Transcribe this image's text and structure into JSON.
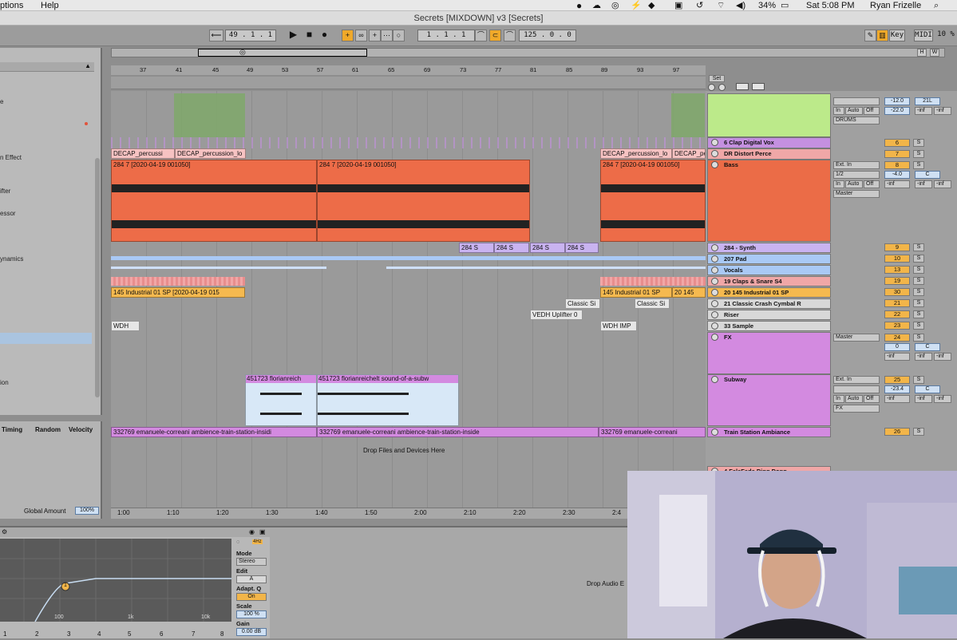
{
  "menubar": {
    "left_items": [
      "ptions",
      "Help"
    ],
    "battery": "34%",
    "clock": "Sat 5:08 PM",
    "user": "Ryan Frizelle"
  },
  "window": {
    "title": "Secrets [MIXDOWN] v3  [Secrets]"
  },
  "transport": {
    "tempo_position": "49 . 1 . 1",
    "loop_start": "1 . 1 . 1",
    "loop_length": "125 . 0 . 0",
    "key_label": "Key",
    "midi_label": "MIDI",
    "cpu": "10 %"
  },
  "browser": {
    "items": [
      "e",
      "n Effect",
      "ifter",
      "essor",
      "ynamics",
      "ion"
    ]
  },
  "groove": {
    "col_timing": "Timing",
    "col_random": "Random",
    "col_velocity": "Velocity",
    "global_amount_label": "Global Amount",
    "global_amount_value": "100%"
  },
  "ruler": {
    "bars": [
      "37",
      "41",
      "45",
      "49",
      "53",
      "57",
      "61",
      "65",
      "69",
      "73",
      "77",
      "81",
      "85",
      "89",
      "93",
      "97"
    ]
  },
  "timebar": {
    "times": [
      "1:00",
      "1:10",
      "1:20",
      "1:30",
      "1:40",
      "1:50",
      "2:00",
      "2:10",
      "2:20",
      "2:30",
      "2:4"
    ]
  },
  "set_label": "Set",
  "clips": {
    "perc1": "DECAP_percussi",
    "perc2": "DECAP_percussion_lo",
    "perc3": "DECAP_percussion_lo",
    "perc4": "DECAP_perc",
    "bass1": "284 7 [2020-04-19 001050]",
    "bass2": "284 7 [2020-04-19 001050]",
    "bass3": "284 7 [2020-04-19 001050]",
    "synth": "284 S",
    "ind1": "145  Industrial  01  SP [2020-04-19 015",
    "ind2": "145  Industrial  01  SP",
    "ind3": "20 145",
    "crash1": "Classic Si",
    "crash2": "Classic Si",
    "riser": "VEDH Uplifter 0",
    "sample1": "WDH",
    "sample2": "WDH  IMP",
    "subway1": "451723    florianreich",
    "subway2": "451723    florianreichelt    sound-of-a-subw",
    "train1": "332769    emanuele-correani    ambience-train-station-insidi",
    "train2": "332769    emanuele-correani    ambience-train-station-inside",
    "train3": "332769    emanuele-correani",
    "drop": "Drop Files and Devices Here"
  },
  "tracks": [
    {
      "name": "6 Clap Digital Vox",
      "num": "6",
      "color": "#c490e0"
    },
    {
      "name": "DR Distort Perce",
      "num": "7",
      "color": "#f0a7a7"
    },
    {
      "name": "Bass",
      "num": "8",
      "color": "#eb6c47"
    },
    {
      "name": "284 - Synth",
      "num": "9",
      "color": "#c9b3f0"
    },
    {
      "name": "207 Pad",
      "num": "10",
      "color": "#a9c9f5"
    },
    {
      "name": "Vocals",
      "num": "13",
      "color": "#a9c9f5"
    },
    {
      "name": "19 Claps & Snare S4",
      "num": "19",
      "color": "#f0a7a7"
    },
    {
      "name": "20 145  Industrial  01  SP",
      "num": "30",
      "color": "#f5b94f"
    },
    {
      "name": "21 Classic Crash Cymbal R",
      "num": "21",
      "color": "#d8d8d8"
    },
    {
      "name": "Riser",
      "num": "22",
      "color": "#d8d8d8"
    },
    {
      "name": "33 Sample",
      "num": "23",
      "color": "#d8d8d8"
    },
    {
      "name": "FX",
      "num": "24",
      "color": "#d38ae0"
    },
    {
      "name": "Subway",
      "num": "25",
      "color": "#d38ae0"
    },
    {
      "name": "Train Station Ambiance",
      "num": "26",
      "color": "#d38ae0"
    }
  ],
  "mixer": {
    "drums_vol": "-12.0",
    "drums_pan": "21L",
    "drums_send": "-22.0",
    "drums_inf1": "-inf",
    "drums_inf2": "-inf",
    "drums_route": "DRUMS",
    "in_label": "In",
    "auto_label": "Auto",
    "off_label": "Off",
    "bass_input": "Ext. In",
    "bass_ch": "1/2",
    "bass_vol": "-4.0",
    "bass_pan": "C",
    "master": "Master",
    "fx_vol": "0",
    "fx_pan": "C",
    "subway_input": "Ext. In",
    "subway_vol": "-23.4",
    "subway_pan": "C",
    "fx_route": "FX",
    "inf": "-inf",
    "solo": "S",
    "last_track_partial": "4 FaleFade Ding Dong"
  },
  "eq": {
    "mode_label": "Mode",
    "mode_value": "Stereo",
    "edit_label": "Edit",
    "edit_value": "A",
    "adapt_label": "Adapt. Q",
    "adapt_value": "On",
    "scale_label": "Scale",
    "scale_value": "100 %",
    "gain_label": "Gain",
    "gain_value": "0.00 dB",
    "freq_labels": [
      "100",
      "1k",
      "10k"
    ],
    "band_numbers": [
      "1",
      "2",
      "3",
      "4",
      "5",
      "6",
      "7",
      "8"
    ],
    "point_label": "1",
    "hz_label": "4Hz"
  },
  "devarea": {
    "drop_text": "Drop Audio E"
  }
}
